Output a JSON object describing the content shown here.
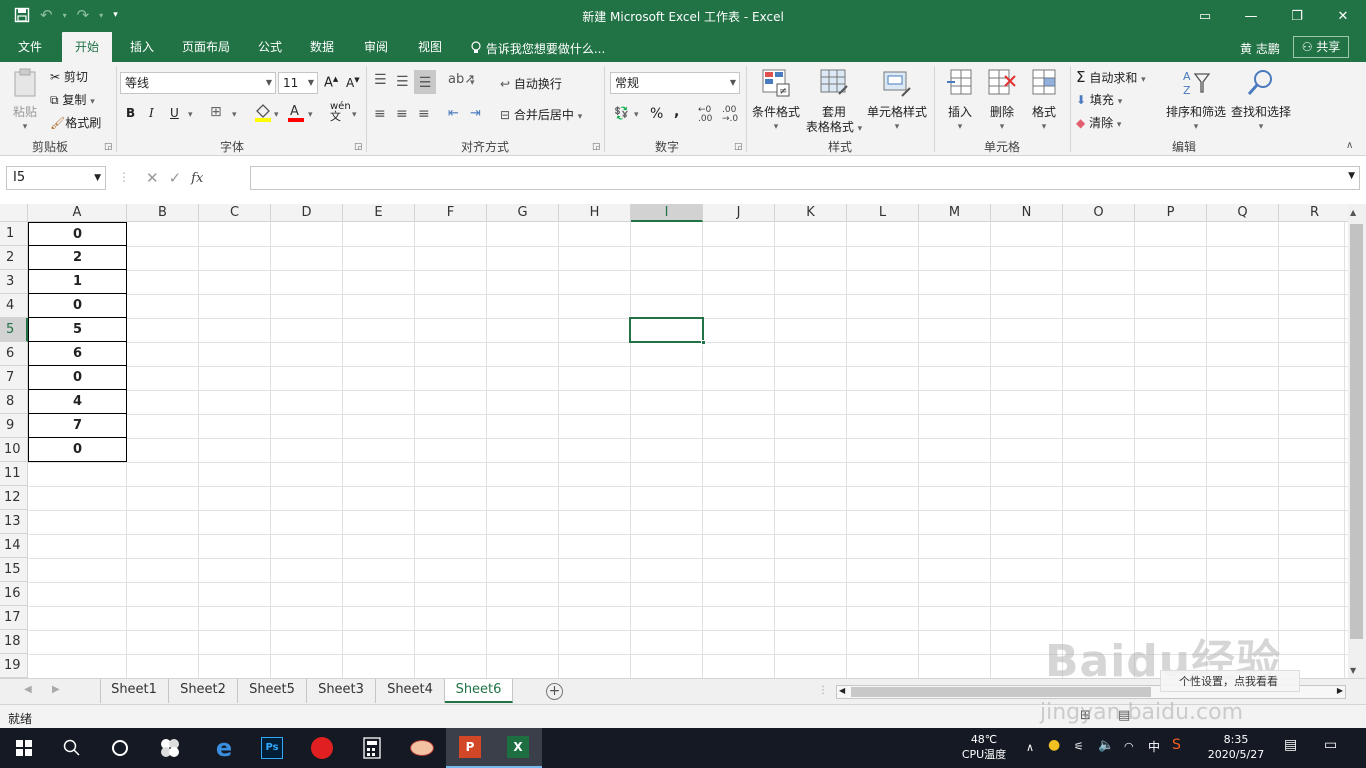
{
  "window": {
    "title": "新建 Microsoft Excel 工作表 - Excel",
    "controls": [
      "▭",
      "—",
      "❐",
      "✕"
    ]
  },
  "menu": {
    "tabs": [
      "文件",
      "开始",
      "插入",
      "页面布局",
      "公式",
      "数据",
      "审阅",
      "视图"
    ],
    "active_tab": "开始",
    "tell_me": "告诉我您想要做什么...",
    "user": "黄 志鹏",
    "share": "共享"
  },
  "ribbon": {
    "clipboard": {
      "paste": "粘贴",
      "cut": "剪切",
      "copy": "复制",
      "format_painter": "格式刷",
      "label": "剪贴板"
    },
    "font": {
      "name": "等线",
      "size": "11",
      "bold": "B",
      "italic": "I",
      "underline": "U",
      "label": "字体",
      "grow": "A",
      "shrink": "A",
      "wen": "wén"
    },
    "alignment": {
      "wrap": "自动换行",
      "merge": "合并后居中",
      "label": "对齐方式"
    },
    "number": {
      "format": "常规",
      "percent": "%",
      "comma": ",",
      "label": "数字"
    },
    "styles": {
      "conditional": "条件格式",
      "table_line1": "套用",
      "table_line2": "表格格式",
      "cell_styles": "单元格样式",
      "label": "样式"
    },
    "cells": {
      "insert": "插入",
      "delete": "删除",
      "format": "格式",
      "label": "单元格"
    },
    "editing": {
      "autosum": "自动求和",
      "fill": "填充",
      "clear": "清除",
      "sort": "排序和筛选",
      "find": "查找和选择",
      "label": "编辑"
    }
  },
  "formula_bar": {
    "name_box": "I5",
    "cancel": "✕",
    "enter": "✓",
    "fx": "fx",
    "value": ""
  },
  "grid": {
    "columns": [
      "A",
      "B",
      "C",
      "D",
      "E",
      "F",
      "G",
      "H",
      "I",
      "J",
      "K",
      "L",
      "M",
      "N",
      "O",
      "P",
      "Q",
      "R"
    ],
    "rows": [
      "1",
      "2",
      "3",
      "4",
      "5",
      "6",
      "7",
      "8",
      "9",
      "10",
      "11",
      "12",
      "13",
      "14",
      "15",
      "16",
      "17",
      "18",
      "19"
    ],
    "selected_column": "I",
    "selected_row": "5",
    "column_a_values": [
      "0",
      "2",
      "1",
      "0",
      "5",
      "6",
      "0",
      "4",
      "7",
      "0"
    ]
  },
  "sheets": {
    "tabs": [
      "Sheet1",
      "Sheet2",
      "Sheet5",
      "Sheet3",
      "Sheet4",
      "Sheet6"
    ],
    "active": "Sheet6",
    "add": "+"
  },
  "status": {
    "ready": "就绪"
  },
  "overlay": {
    "watermark": "Baidu经验",
    "watermark_url": "jingyan.baidu.com",
    "popup": "个性设置，点我看看"
  },
  "taskbar": {
    "cpu_temp": "48℃",
    "cpu_label": "CPU温度",
    "ime": "中",
    "time": "8:35",
    "date": "2020/5/27"
  },
  "colors": {
    "excel_green": "#217346",
    "taskbar": "#141923"
  }
}
